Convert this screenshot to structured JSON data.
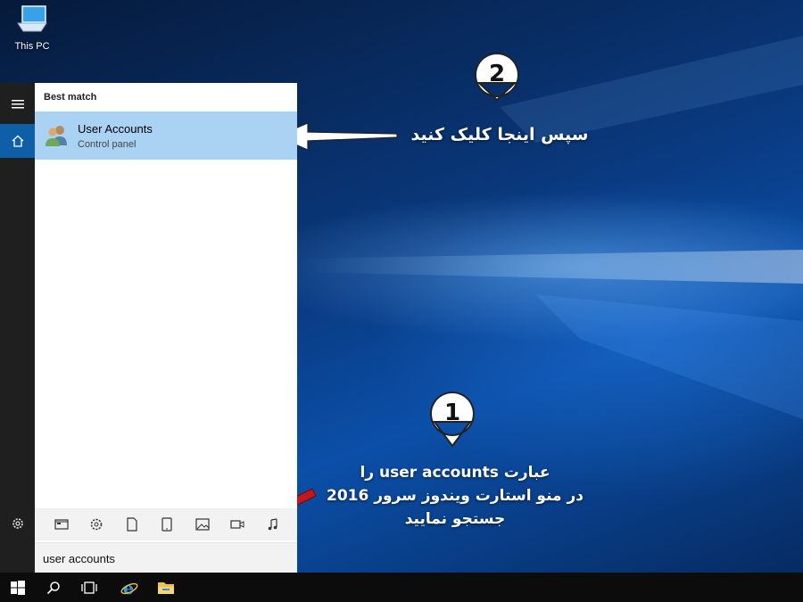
{
  "desktop": {
    "icons": [
      {
        "label": "This PC",
        "icon": "monitor-icon"
      }
    ]
  },
  "start_menu": {
    "rail": {
      "menu_icon": "hamburger-icon",
      "home_icon": "home-icon",
      "settings_icon": "gear-icon"
    },
    "section_header": "Best match",
    "best_result": {
      "title": "User Accounts",
      "subtitle": "Control panel",
      "icon": "user-accounts-icon"
    },
    "filters": [
      "apps-icon",
      "settings-icon",
      "documents-icon",
      "tablet-icon",
      "photos-icon",
      "videos-icon",
      "music-icon"
    ],
    "search": {
      "value": "user accounts"
    }
  },
  "taskbar": {
    "items": [
      "windows-start-icon",
      "search-icon",
      "task-view-icon",
      "internet-explorer-icon",
      "file-explorer-icon"
    ]
  },
  "annotations": {
    "step1": {
      "number": "1",
      "line1": "عبارت user accounts را",
      "line2": "در منو استارت ویندوز سرور 2016",
      "line3": "جستجو نمایید"
    },
    "step2": {
      "number": "2",
      "text": "سپس اینجا کلیک کنید"
    }
  },
  "colors": {
    "accent": "#0f5fa8",
    "highlight": "#aad3f3",
    "arrow_red": "#c4161c"
  }
}
